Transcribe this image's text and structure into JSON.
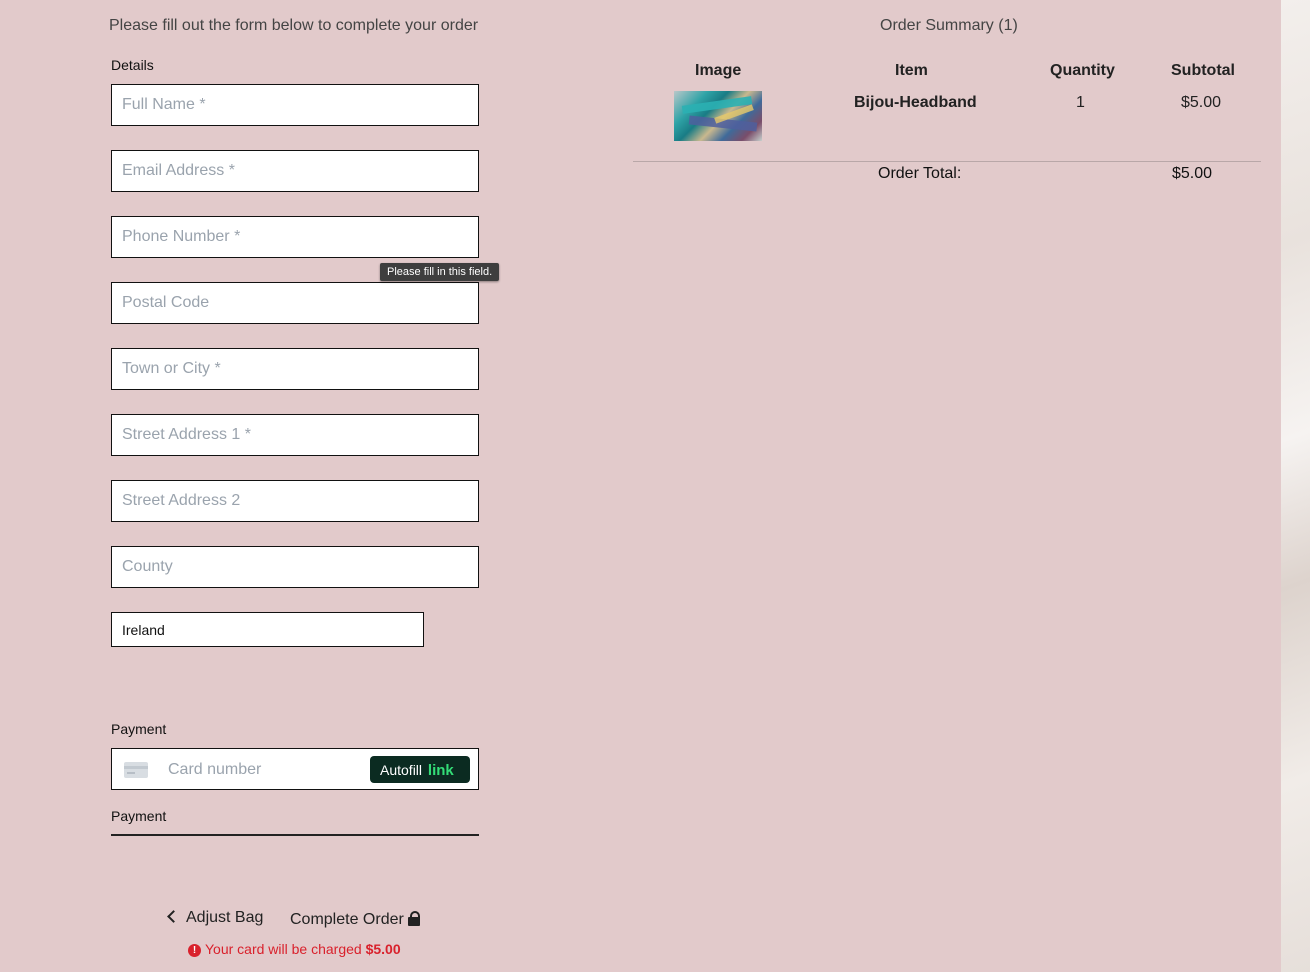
{
  "intro_text": "Please fill out the form below to complete your order",
  "details": {
    "label": "Details",
    "fields": {
      "full_name": "Full Name *",
      "email": "Email Address *",
      "phone": "Phone Number *",
      "postal_code": "Postal Code",
      "town_city": "Town or City *",
      "street1": "Street Address 1 *",
      "street2": "Street Address 2",
      "county": "County"
    },
    "country": "Ireland"
  },
  "tooltip": "Please fill in this field.",
  "payment": {
    "label": "Payment",
    "card_placeholder": "Card number",
    "autofill_label": "Autofill",
    "autofill_brand": "link",
    "secondary_label": "Payment"
  },
  "actions": {
    "adjust_bag": "Adjust Bag",
    "complete_order": "Complete Order",
    "charge_prefix": "Your card will be charged",
    "charge_amount": "$5.00"
  },
  "summary": {
    "title": "Order Summary (1)",
    "headers": {
      "image": "Image",
      "item": "Item",
      "quantity": "Quantity",
      "subtotal": "Subtotal"
    },
    "items": [
      {
        "name": "Bijou-Headband",
        "quantity": "1",
        "subtotal": "$5.00",
        "image_icon": "headband-product-image"
      }
    ],
    "total_label": "Order Total:",
    "total_value": "$5.00"
  },
  "colors": {
    "background": "#e2cacb",
    "error": "#d9212c",
    "autofill_bg": "#0b2b21",
    "link_green": "#33dd77"
  }
}
